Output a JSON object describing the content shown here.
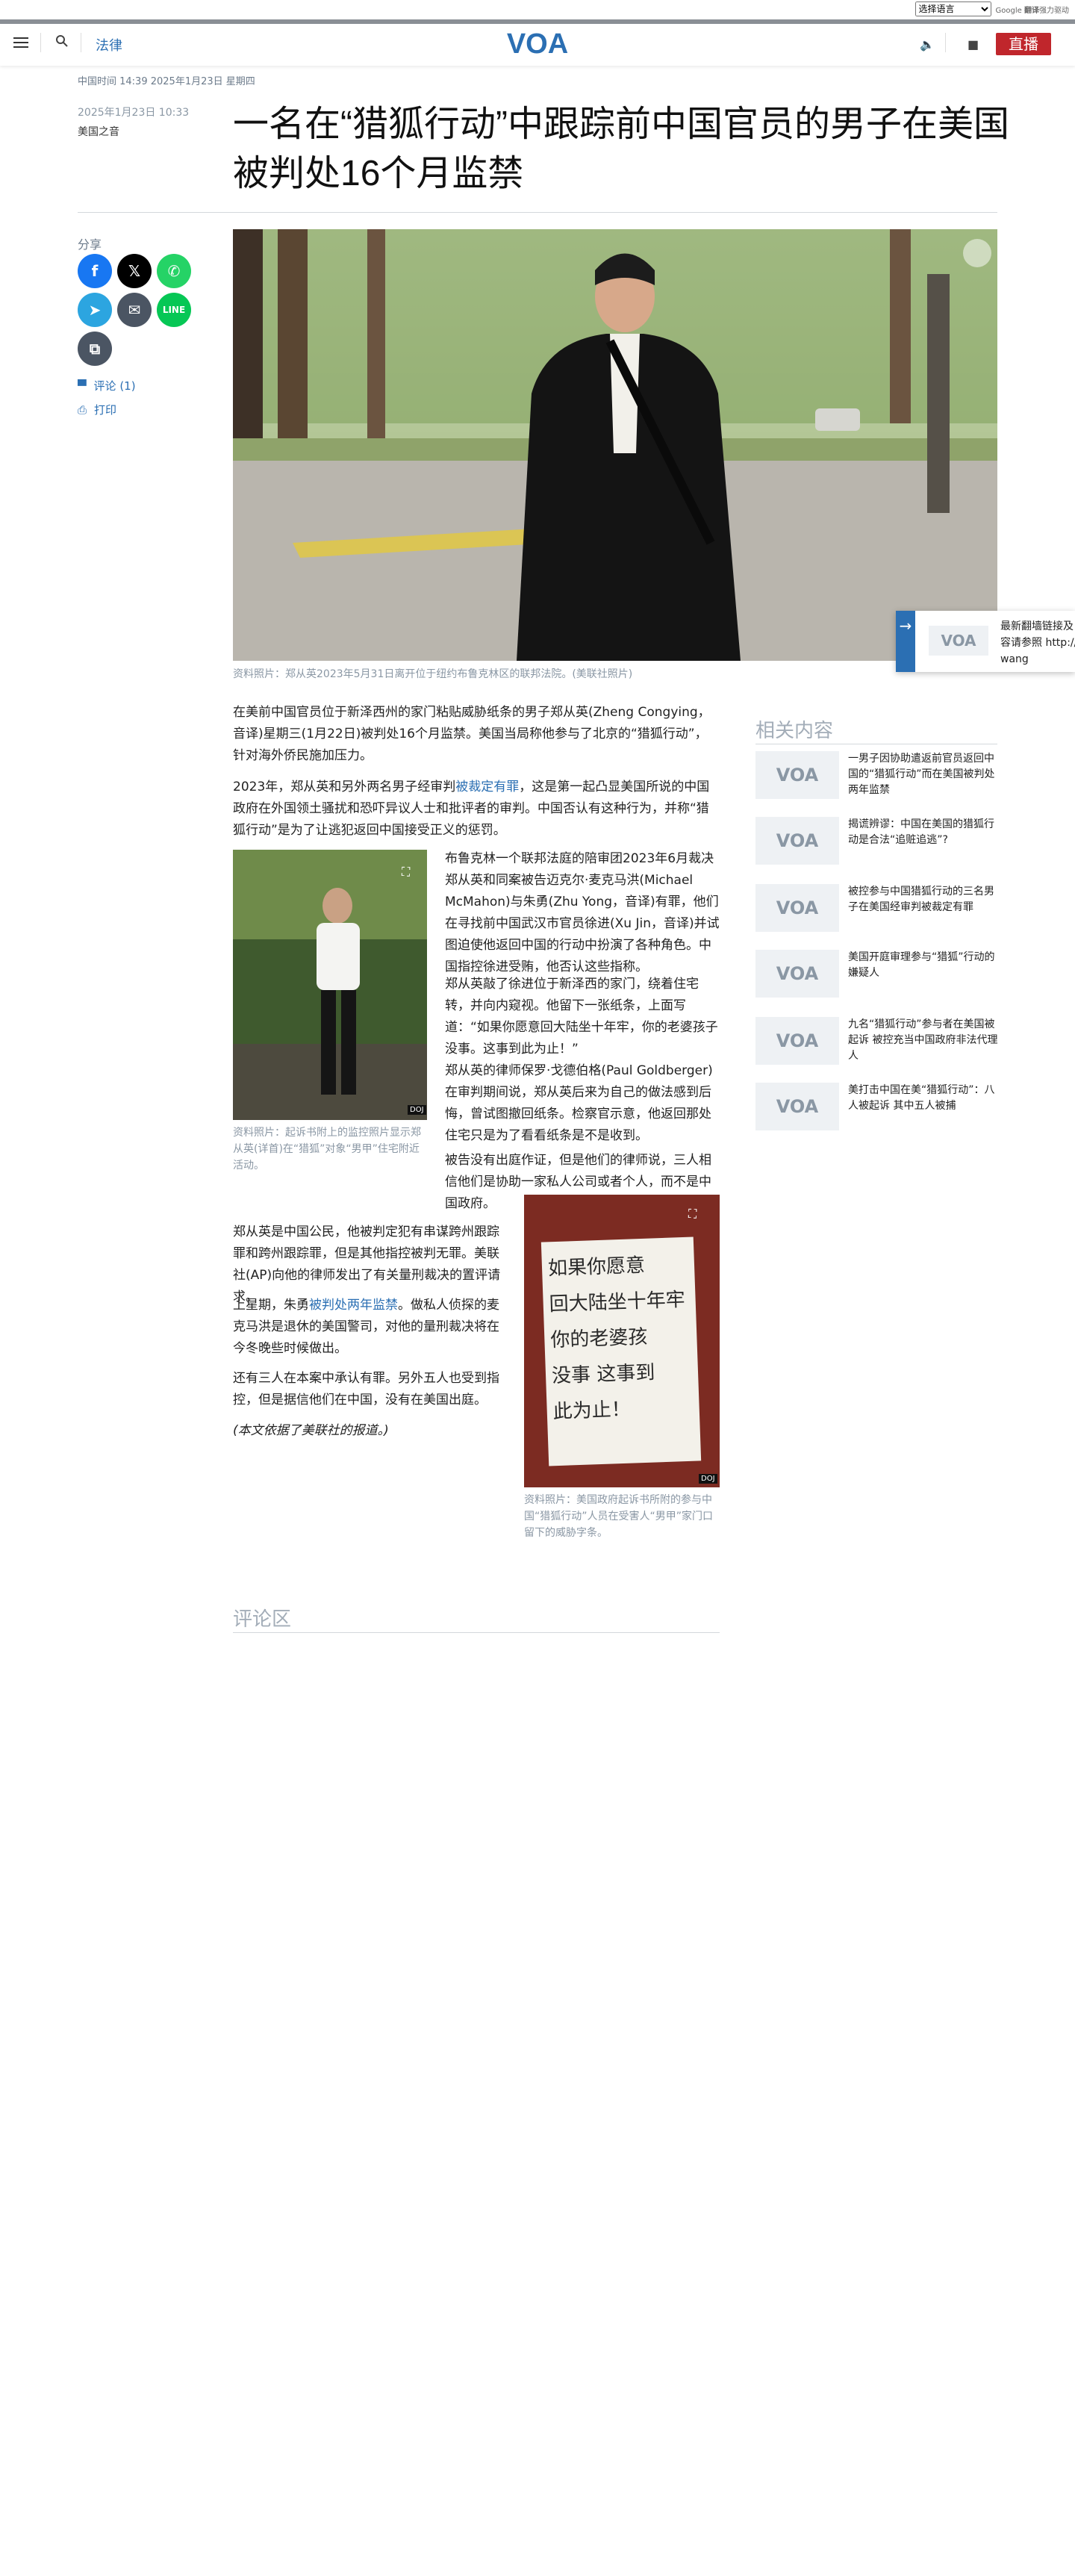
{
  "translate": {
    "select_label": "选择语言",
    "powered": "Google",
    "powered_word": "翻译",
    "powered_suffix": "强力驱动"
  },
  "header": {
    "section": "法律",
    "logo_text": "VOA",
    "live_label": "直播"
  },
  "article": {
    "timestamp": "中国时间 14:39 2025年1月23日 星期四",
    "published": "2025年1月23日 10:33",
    "byline": "美国之音",
    "headline": "一名在“猎狐行动”中跟踪前中国官员的男子在美国被判处16个月监禁",
    "hero_caption": "资料照片：郑从英2023年5月31日离开位于纽约布鲁克林区的联邦法院。(美联社照片)",
    "p1": "在美前中国官员位于新泽西州的家门粘贴威胁纸条的男子郑从英(Zheng Congying，音译)星期三(1月22日)被判处16个月监禁。美国当局称他参与了北京的“猎狐行动”，针对海外侨民施加压力。",
    "p2_before": "2023年，郑从英和另外两名男子经审判",
    "p2_link": "被裁定有罪",
    "p2_after": "，这是第一起凸显美国所说的中国政府在外国领土骚扰和恐吓异议人士和批评者的审判。中国否认有这种行为，并称“猎狐行动”是为了让逃犯返回中国接受正义的惩罚。",
    "img2_caption": "资料照片：起诉书附上的监控照片显示郑从英(详首)在“猎狐”对象“男甲”住宅附近活动。",
    "p3": "布鲁克林一个联邦法庭的陪审团2023年6月裁决郑从英和同案被告迈克尔·麦克马洪(Michael McMahon)与朱勇(Zhu Yong，音译)有罪，他们在寻找前中国武汉市官员徐进(Xu Jin，音译)并试图迫使他返回中国的行动中扮演了各种角色。中国指控徐进受贿，他否认这些指称。",
    "p4": "郑从英敲了徐进位于新泽西的家门，绕着住宅转，并向内窥视。他留下一张纸条，上面写道：“如果你愿意回大陆坐十年牢，你的老婆孩子没事。这事到此为止！”",
    "p5": "郑从英的律师保罗·戈德伯格(Paul Goldberger)在审判期间说，郑从英后来为自己的做法感到后悔，曾试图撤回纸条。检察官示意，他返回那处住宅只是为了看看纸条是不是收到。",
    "p6": "被告没有出庭作证，但是他们的律师说，三人相信他们是协助一家私人公司或者个人，而不是中国政府。",
    "p7": "郑从英是中国公民，他被判定犯有串谋跨州跟踪罪和跨州跟踪罪，但是其他指控被判无罪。美联社(AP)向他的律师发出了有关量刑裁决的置评请求。",
    "p8_before": "上星期，朱勇",
    "p8_link": "被判处两年监禁",
    "p8_after": "。做私人侦探的麦克马洪是退休的美国警司，对他的量刑裁决将在今冬晚些时候做出。",
    "p9": "还有三人在本案中承认有罪。另外五人也受到指控，但是据信他们在中国，没有在美国出庭。",
    "p10": "(本文依据了美联社的报道。)",
    "img3_caption": "资料照片：美国政府起诉书所附的参与中国“猎狐行动”人员在受害人“男甲”家门口留下的威胁字条。",
    "note_text": [
      "如果你愿意",
      "回大陆坐十年牢",
      "你的老婆孩",
      "没事 这事到",
      "此为止！"
    ],
    "doj_tag": "DOJ"
  },
  "share": {
    "label": "分享",
    "comments": "评论 (1)",
    "print": "打印"
  },
  "related": {
    "title": "相关内容",
    "items": [
      "一男子因协助遣返前官员返回中国的“猎狐行动”而在美国被判处两年监禁",
      "揭谎辨谬：中国在美国的猎狐行动是合法“追赃追逃”?",
      "被控参与中国猎狐行动的三名男子在美国经审判被裁定有罪",
      "美国开庭审理参与“猎狐”行动的嫌疑人",
      "九名“猎狐行动”参与者在美国被起诉 被控充当中国政府非法代理人",
      "美打击中国在美“猎狐行动”：八人被起诉 其中五人被捕"
    ]
  },
  "comments": {
    "title": "评论区"
  },
  "fab": {
    "line1": "最新翻墙链接及",
    "line2": "容请参照 http://t",
    "line3": "wang"
  },
  "colors": {
    "accent": "#2b6fb3",
    "live": "#c0262c",
    "facebook": "#1877f2",
    "x": "#000000",
    "whatsapp": "#25d366",
    "telegram": "#2ca5e0",
    "email": "#4b5563",
    "line": "#06c755",
    "copy": "#4b5563"
  }
}
